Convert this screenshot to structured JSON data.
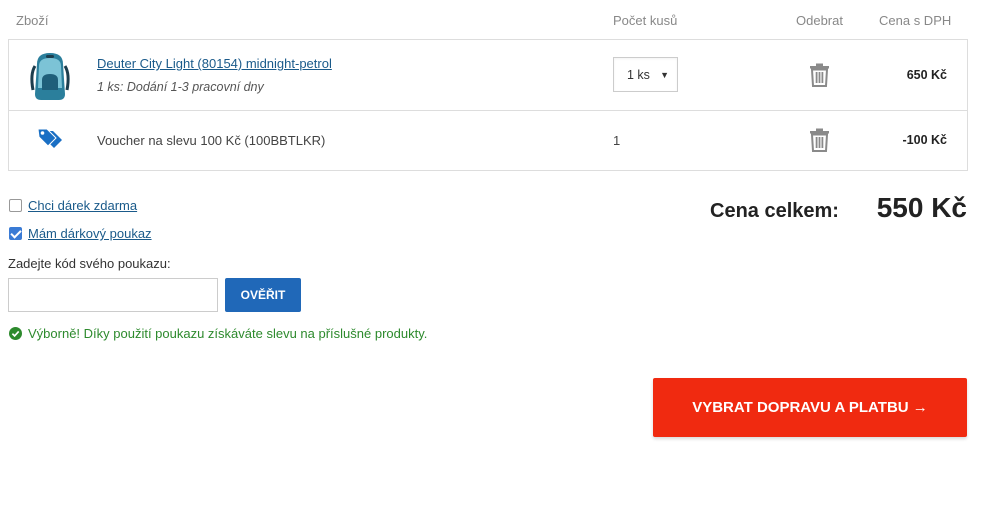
{
  "table_header": {
    "product": "Zboží",
    "quantity": "Počet kusů",
    "remove": "Odebrat",
    "price": "Cena s DPH"
  },
  "items": [
    {
      "name": "Deuter City Light (80154) midnight-petrol",
      "delivery": "1 ks: Dodání 1-3 pracovní dny",
      "quantity": "1 ks",
      "price": "650 Kč",
      "thumbnail_icon": "backpack-image"
    },
    {
      "name": "Voucher na slevu 100 Kč (100BBTLKR)",
      "quantity": "1",
      "price": "-100 Kč",
      "icon": "tag-icon"
    }
  ],
  "options": {
    "free_gift": {
      "label": "Chci dárek zdarma",
      "checked": false
    },
    "gift_voucher": {
      "label": "Mám dárkový poukaz",
      "checked": true
    }
  },
  "voucher": {
    "code_label": "Zadejte kód svého poukazu:",
    "code_value": "",
    "verify_button": "OVĚŘIT",
    "success_message": "Výborně! Díky použití poukazu získáváte slevu na příslušné produkty."
  },
  "summary": {
    "total_label": "Cena celkem:",
    "total_value": "550 Kč"
  },
  "cta": {
    "label": "VYBRAT DOPRAVU A PLATBU →"
  },
  "colors": {
    "link": "#1a5a8a",
    "primary_button": "#2068b8",
    "cta": "#f02a10",
    "success": "#2d8a2d",
    "tag_icon": "#1a6fc4"
  }
}
